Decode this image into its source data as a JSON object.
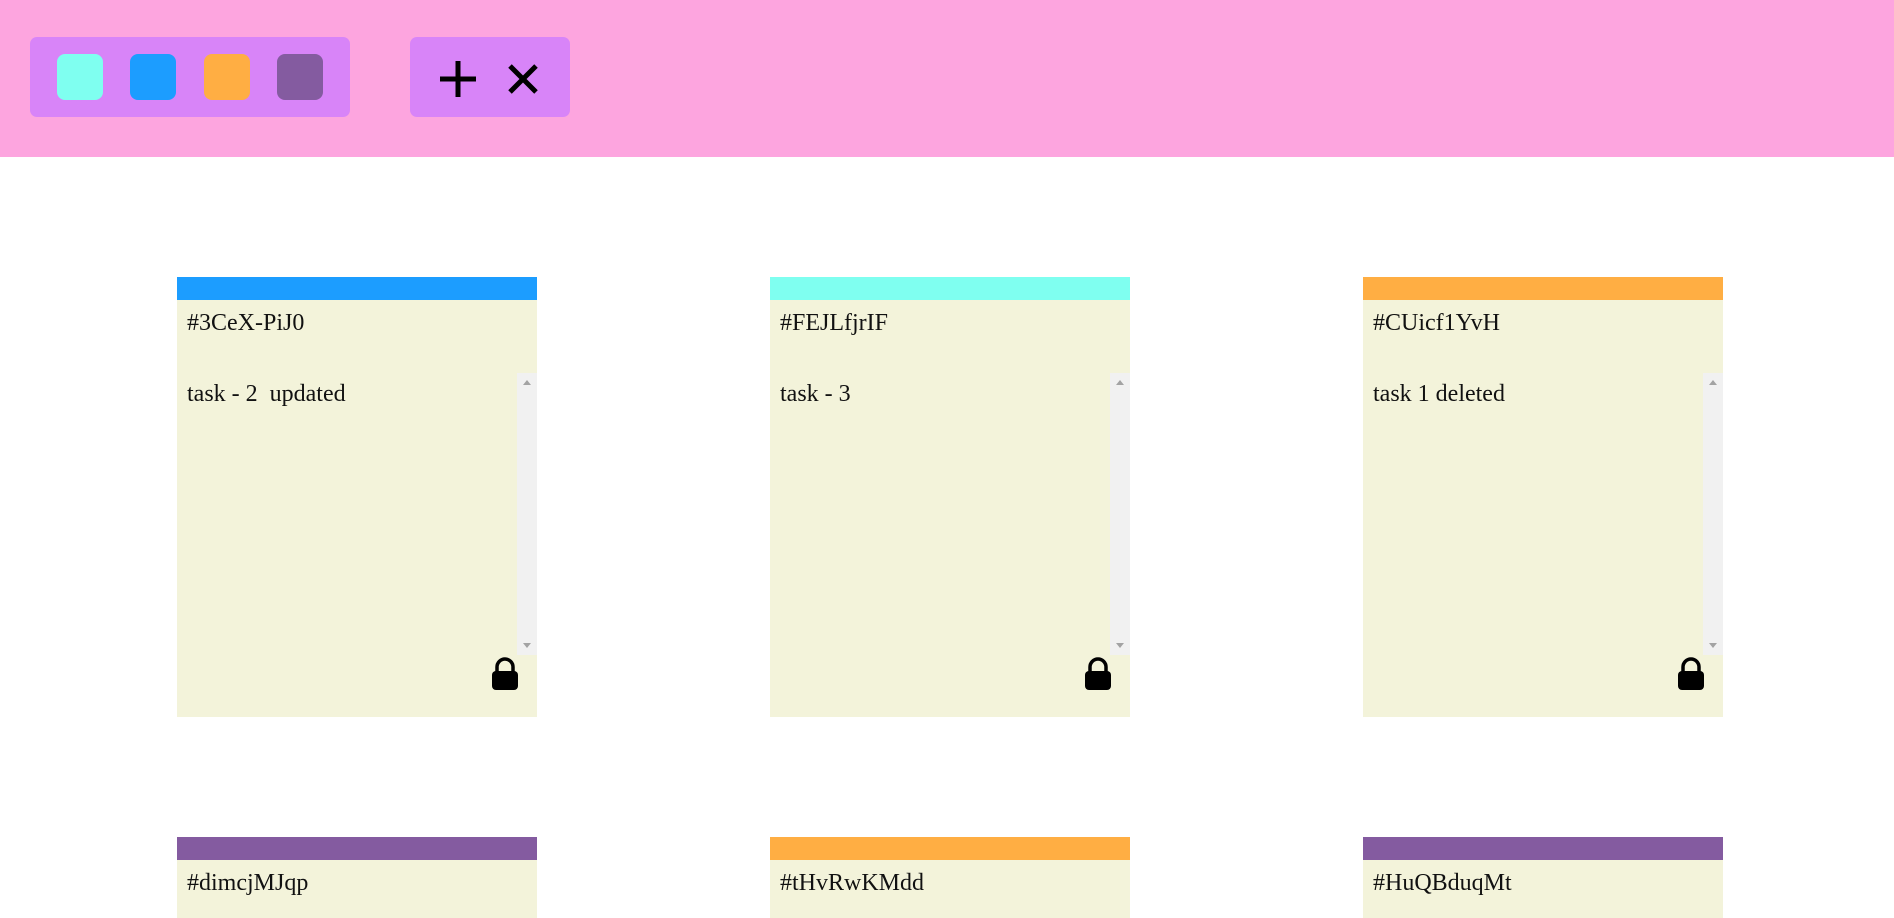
{
  "colors": {
    "toolbar_bg": "#fda5df",
    "panel_bg": "#d884f8",
    "ticket_bg": "#f3f3da",
    "aqua": "#7ffff0",
    "blue": "#1c9dff",
    "orange": "#ffae43",
    "purple": "#845ba0"
  },
  "toolbar": {
    "filters": [
      {
        "name": "filter-aqua",
        "color": "#7ffff0"
      },
      {
        "name": "filter-blue",
        "color": "#1c9dff"
      },
      {
        "name": "filter-orange",
        "color": "#ffae43"
      },
      {
        "name": "filter-purple",
        "color": "#845ba0"
      }
    ],
    "actions": [
      {
        "name": "add-button",
        "icon": "plus-icon"
      },
      {
        "name": "remove-button",
        "icon": "close-icon"
      }
    ]
  },
  "tickets": [
    {
      "id": "#3CeX-PiJ0",
      "task": "task - 2  updated",
      "color": "#1c9dff",
      "lock_icon": "lock-icon"
    },
    {
      "id": "#FEJLfjrIF",
      "task": "task - 3",
      "color": "#7ffff0",
      "lock_icon": "lock-icon"
    },
    {
      "id": "#CUicf1YvH",
      "task": "task 1 deleted",
      "color": "#ffae43",
      "lock_icon": "lock-icon"
    },
    {
      "id": "#dimcjMJqp",
      "task": "",
      "color": "#845ba0",
      "lock_icon": "lock-icon"
    },
    {
      "id": "#tHvRwKMdd",
      "task": "",
      "color": "#ffae43",
      "lock_icon": "lock-icon"
    },
    {
      "id": "#HuQBduqMt",
      "task": "",
      "color": "#845ba0",
      "lock_icon": "lock-icon"
    }
  ]
}
